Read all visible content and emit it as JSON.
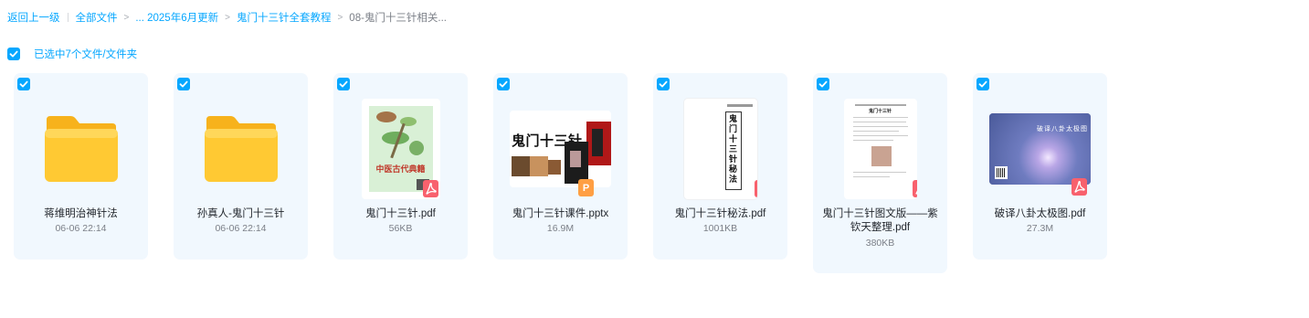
{
  "breadcrumb": {
    "back": "返回上一级",
    "root": "全部文件",
    "middle": "... 2025年6月更新",
    "parent": "鬼门十三针全套教程",
    "current": "08-鬼门十三针相关..."
  },
  "selection": {
    "label": "已选中7个文件/文件夹"
  },
  "colors": {
    "accent": "#06a7ff",
    "card_bg": "#f1f8fe",
    "pdf_badge": "#f8616d",
    "ppt_badge": "#ff9f43",
    "folder": "#ffc933"
  },
  "items": [
    {
      "name": "蒋维明治神针法",
      "meta": "06-06 22:14",
      "type": "folder",
      "icon": "folder-icon",
      "selected": true
    },
    {
      "name": "孙真人-鬼门十三针",
      "meta": "06-06 22:14",
      "type": "folder",
      "icon": "folder-icon",
      "selected": true
    },
    {
      "name": "鬼门十三针.pdf",
      "meta": "56KB",
      "type": "pdf",
      "icon": "pdf-badge-icon",
      "thumb_text": "中医古代典籍",
      "selected": true
    },
    {
      "name": "鬼门十三针课件.pptx",
      "meta": "16.9M",
      "type": "pptx",
      "icon": "ppt-badge-icon",
      "thumb_text": "鬼门十三针",
      "badge_letter": "P",
      "selected": true
    },
    {
      "name": "鬼门十三针秘法.pdf",
      "meta": "1001KB",
      "type": "pdf",
      "icon": "pdf-badge-icon",
      "thumb_text": "鬼门十三针秘法",
      "selected": true
    },
    {
      "name": "鬼门十三针图文版——紫钦天整理.pdf",
      "meta": "380KB",
      "type": "pdf",
      "icon": "pdf-badge-icon",
      "thumb_text": "鬼门十三针",
      "selected": true
    },
    {
      "name": "破译八卦太极图.pdf",
      "meta": "27.3M",
      "type": "pdf",
      "icon": "pdf-badge-icon",
      "thumb_text": "破译八卦太极图",
      "selected": true
    }
  ]
}
